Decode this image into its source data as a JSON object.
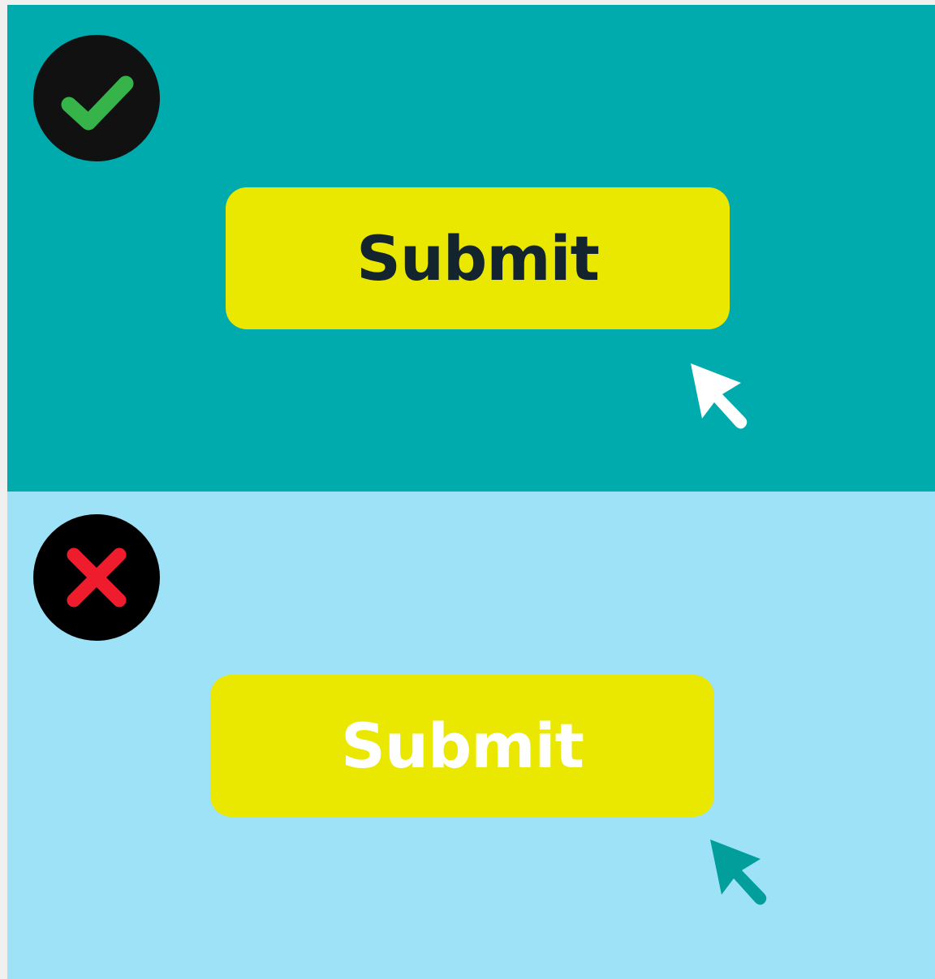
{
  "panels": {
    "good": {
      "background": "#00abae",
      "badge": {
        "icon": "check-icon",
        "circle": "#111111",
        "mark": "#36b44a"
      },
      "button": {
        "label": "Submit",
        "fill": "#eae800",
        "text_color": "#13242e"
      },
      "cursor": {
        "icon": "arrow-cursor-icon",
        "color": "#ffffff"
      }
    },
    "bad": {
      "background": "#9de2f6",
      "badge": {
        "icon": "cross-icon",
        "circle": "#000000",
        "mark": "#ef1c2e"
      },
      "button": {
        "label": "Submit",
        "fill": "#eae800",
        "text_color": "#ffffff"
      },
      "cursor": {
        "icon": "arrow-cursor-icon",
        "color": "#019e9b"
      }
    }
  }
}
